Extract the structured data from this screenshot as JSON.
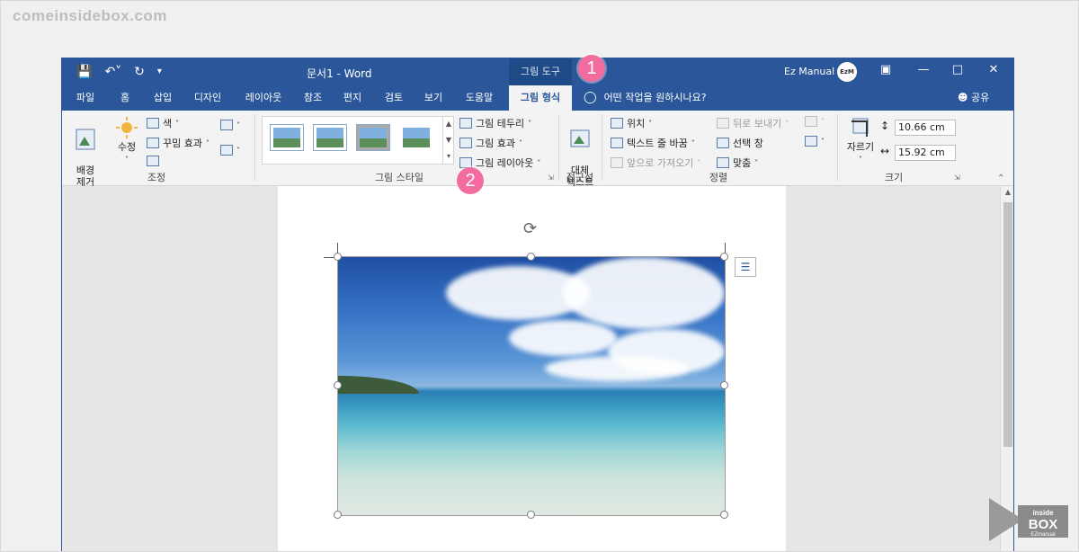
{
  "watermark": "comeinsidebox.com",
  "window": {
    "doc_title": "문서1  -  Word",
    "tools_label": "그림 도구",
    "user_name": "Ez Manual",
    "avatar_text": "EzM"
  },
  "callouts": [
    "1",
    "2"
  ],
  "tabs": [
    "파일",
    "홈",
    "삽입",
    "디자인",
    "레이아웃",
    "참조",
    "편지",
    "검토",
    "보기",
    "도움말",
    "그림 형식"
  ],
  "tell_me": "어떤 작업을 원하시나요?",
  "share": "공유",
  "ribbon": {
    "adjust": {
      "remove_bg": "배경\n제거",
      "corrections": "수정",
      "color": "색",
      "artistic": "꾸밈 효과",
      "label": "조정"
    },
    "styles": {
      "border": "그림 테두리",
      "effects": "그림 효과",
      "layout": "그림 레이아웃",
      "label": "그림 스타일"
    },
    "accessibility": {
      "alt_text": "대체\n텍스트",
      "label": "접근성"
    },
    "arrange": {
      "position": "위치",
      "wrap_text": "텍스트 줄 바꿈",
      "bring_forward": "앞으로 가져오기",
      "send_backward": "뒤로 보내기",
      "selection_pane": "선택 창",
      "align": "맞춤",
      "label": "정렬"
    },
    "size": {
      "crop": "자르기",
      "height": "10.66 cm",
      "width": "15.92 cm",
      "label": "크기"
    }
  },
  "colors": {
    "word_blue": "#2b579a",
    "callout_pink": "#f46ba0"
  }
}
